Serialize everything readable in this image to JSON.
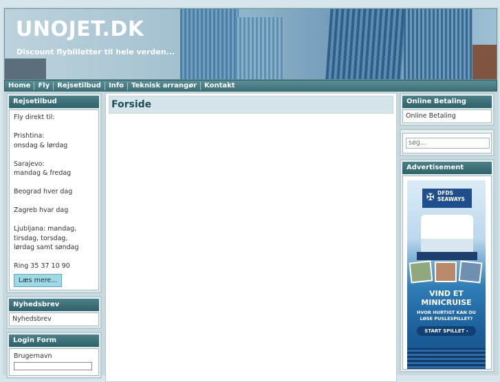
{
  "header": {
    "title": "UNOJET.DK",
    "slogan": "Discount flybilletter til hele verden..."
  },
  "nav": {
    "items": [
      "Home",
      "Fly",
      "Rejsetilbud",
      "Info",
      "Teknisk arrangør",
      "Kontakt"
    ]
  },
  "left": {
    "rejsetilbud": {
      "title": "Rejsetilbud",
      "lines": [
        "Fly direkt til:",
        "",
        "Prishtina:",
        "onsdag & lørdag",
        "",
        "Sarajevo:",
        "mandag & fredag",
        "",
        "Beograd hver dag",
        "",
        "Zagreb hvar dag",
        "",
        "Ljubljana: mandag,",
        "tirsdag, torsdag,",
        "lørdag samt søndag",
        "",
        "Ring 35 37 10 90"
      ],
      "button": "Læs mere..."
    },
    "nyhedsbrev": {
      "title": "Nyhedsbrev",
      "link": "Nyhedsbrev"
    },
    "login": {
      "title": "Login Form",
      "username_label": "Brugernavn"
    }
  },
  "main": {
    "title": "Forside"
  },
  "right": {
    "online": {
      "title": "Online Betaling",
      "link": "Online Betaling"
    },
    "search": {
      "placeholder": "søg..."
    },
    "ad": {
      "title": "Advertisement",
      "brand_line1": "DFDS",
      "brand_line2": "SEAWAYS",
      "headline_line1": "VIND ET",
      "headline_line2": "MINICRUISE",
      "question_line1": "HVOR HURTIGT KAN DU",
      "question_line2": "LØSE PUSLESPILLET?",
      "cta": "START SPILLET ›"
    }
  }
}
